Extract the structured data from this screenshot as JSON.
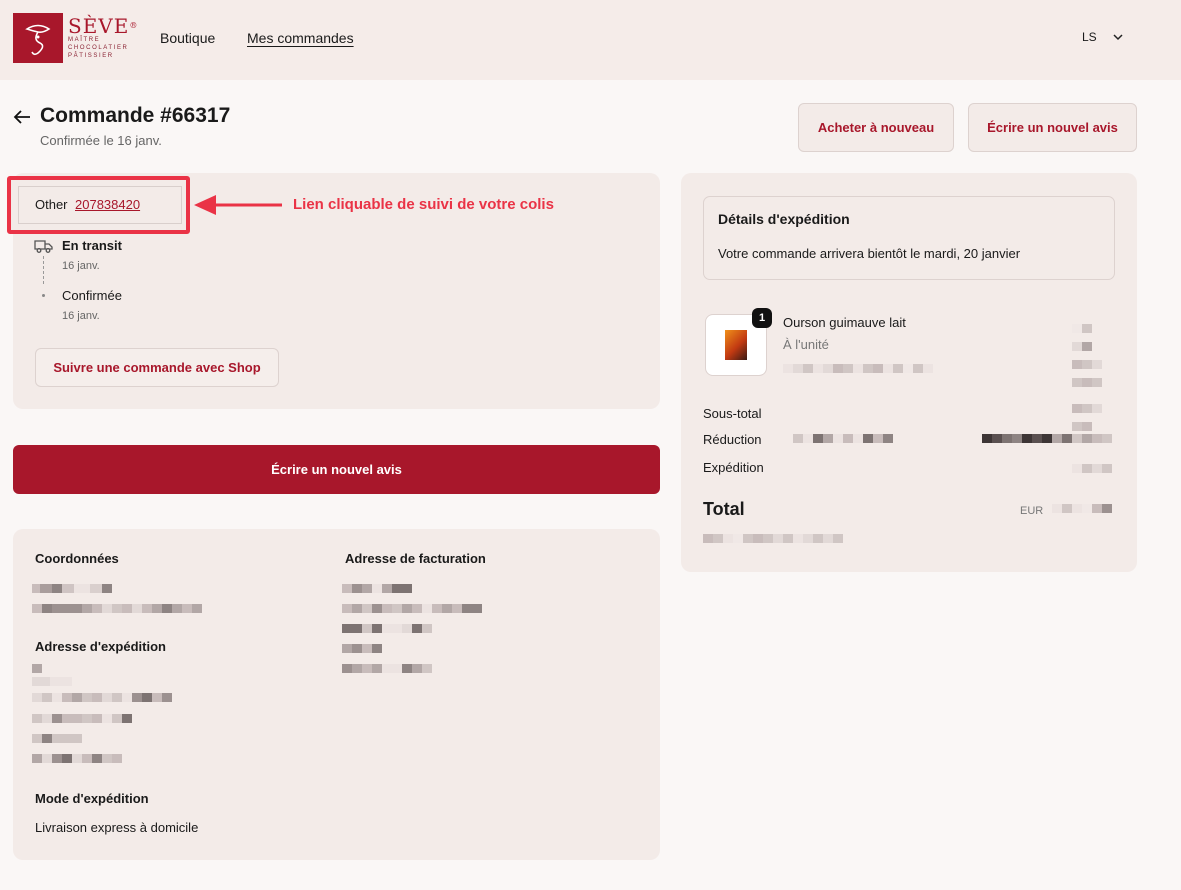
{
  "brand": {
    "name": "SÈVE",
    "registered": "®",
    "tagline_1": "MAÎTRE",
    "tagline_2": "CHOCOLATIER",
    "tagline_3": "PÂTISSIER",
    "color": "#a8172b"
  },
  "nav": {
    "shop": "Boutique",
    "orders": "Mes commandes"
  },
  "account": {
    "initials": "LS",
    "icon": "chevron-down-icon"
  },
  "order": {
    "title": "Commande #66317",
    "subtitle": "Confirmée le 16 janv.",
    "buy_again_label": "Acheter à nouveau",
    "review_label": "Écrire un nouvel avis"
  },
  "tracking": {
    "carrier": "Other",
    "number": "207838420",
    "annotation": "Lien cliquable de suivi de votre colis",
    "annotation_color": "#ea3346",
    "steps": [
      {
        "label": "En transit",
        "date": "16 janv.",
        "icon": "truck-icon"
      },
      {
        "label": "Confirmée",
        "date": "16 janv."
      }
    ],
    "shop_button": "Suivre une commande avec Shop"
  },
  "review_button": "Écrire un nouvel avis",
  "info": {
    "contact_heading": "Coordonnées",
    "billing_heading": "Adresse de facturation",
    "shipping_heading": "Adresse d'expédition",
    "shipping_mode_heading": "Mode d'expédition",
    "shipping_mode": "Livraison express à domicile"
  },
  "summary": {
    "shipping_details_heading": "Détails d'expédition",
    "shipping_details_message": "Votre commande arrivera bientôt le mardi, 20 janvier",
    "product": {
      "name": "Ourson guimauve lait",
      "variant": "À l'unité",
      "quantity": "1"
    },
    "subtotal_label": "Sous-total",
    "discount_label": "Réduction",
    "shipping_label": "Expédition",
    "total_label": "Total",
    "currency": "EUR"
  }
}
